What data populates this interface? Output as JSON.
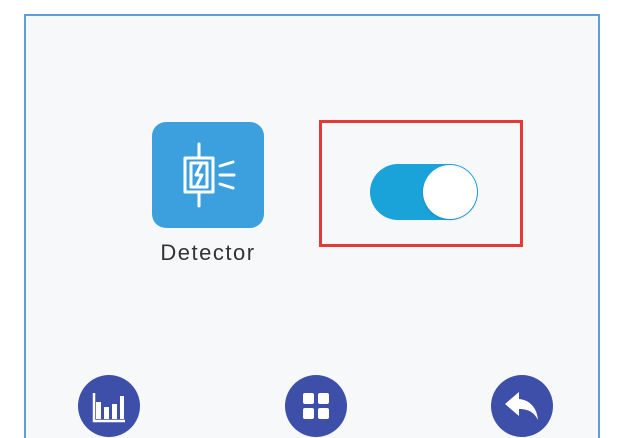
{
  "detector": {
    "label": "Detector",
    "icon": "detector-sensor-icon"
  },
  "toggle": {
    "state": "on",
    "color": "#1aa3d9"
  },
  "nav": {
    "items": [
      {
        "icon": "bar-chart-icon"
      },
      {
        "icon": "grid-menu-icon"
      },
      {
        "icon": "back-arrow-icon"
      }
    ],
    "color": "#3d4fa8"
  },
  "colors": {
    "tile": "#3ba0dd",
    "highlight": "#e53935",
    "frame": "#5f9fd6"
  }
}
